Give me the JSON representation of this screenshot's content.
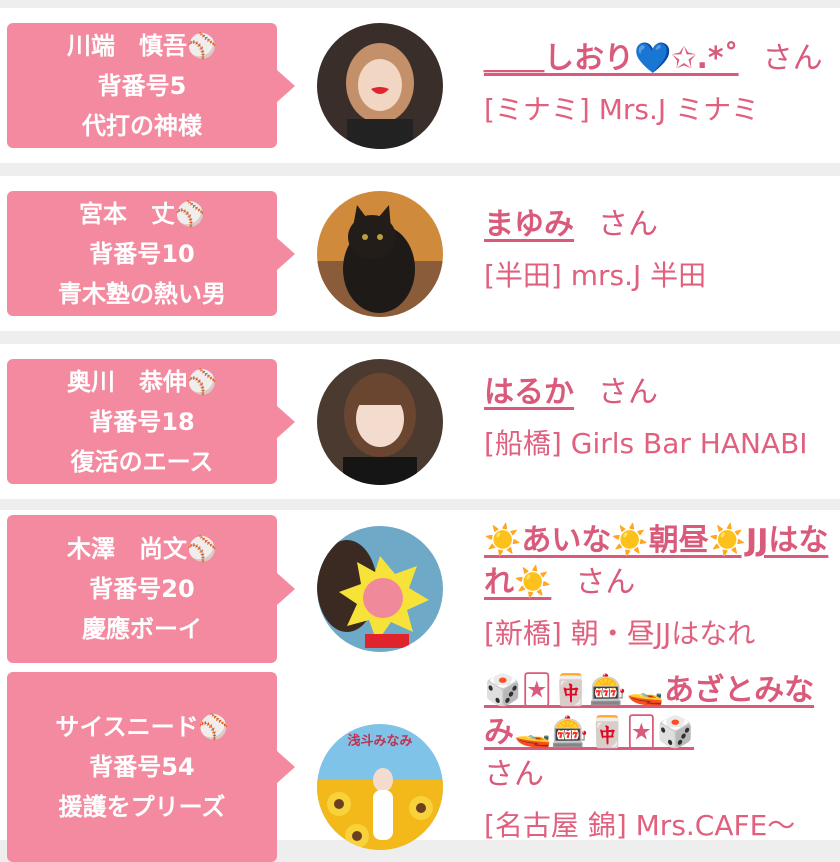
{
  "cast_list": [
    {
      "player_name": "川端　慎吾",
      "ball_icon": "⚾",
      "number": "背番号5",
      "catchphrase": "代打の神様",
      "prefix": "＿＿",
      "girl_name": "しおり💙✩.*˚",
      "honorific": "さん",
      "shop": "[ミナミ] Mrs.J ミナミ"
    },
    {
      "player_name": "宮本　丈",
      "ball_icon": "⚾",
      "number": "背番号10",
      "catchphrase": "青木塾の熱い男",
      "prefix": "",
      "girl_name": "まゆみ",
      "honorific": "さん",
      "shop": "[半田] mrs.J 半田"
    },
    {
      "player_name": "奥川　恭伸",
      "ball_icon": "⚾",
      "number": "背番号18",
      "catchphrase": "復活のエース",
      "prefix": "",
      "girl_name": "はるか",
      "honorific": "さん",
      "shop": "[船橋] Girls Bar HANABI"
    },
    {
      "player_name": "木澤　尚文",
      "ball_icon": "⚾",
      "number": "背番号20",
      "catchphrase": "慶應ボーイ",
      "prefix": "",
      "girl_name": "☀️あいな☀️朝昼☀️JJはなれ☀️",
      "honorific": "さん",
      "shop": "[新橋] 朝・昼JJはなれ"
    },
    {
      "player_name": "サイスニード",
      "ball_icon": "⚾",
      "number": "背番号54",
      "catchphrase": "援護をプリーズ",
      "prefix": "",
      "girl_name": "🎲🃏🀄🎰🚤あざとみなみ🚤🎰🀄🃏🎲",
      "honorific": "さん",
      "shop": "[名古屋 錦] Mrs.CAFE〜",
      "avatar_text": "浅斗みなみ"
    }
  ],
  "avatar_icons": [
    "photo-portrait-icon",
    "black-cat-icon",
    "photo-portrait-icon",
    "fist-sticker-icon",
    "sunflower-photo-icon"
  ],
  "colors": {
    "badge": "#f48aa0",
    "text": "#d95a7a",
    "row_bg": "#ffffff",
    "page_bg": "#eeeeee"
  }
}
